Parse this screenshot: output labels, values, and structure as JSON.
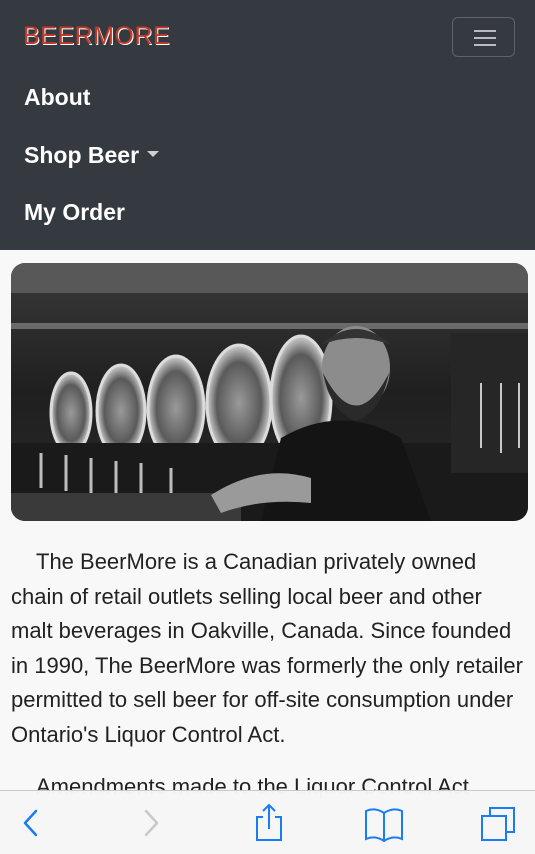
{
  "navbar": {
    "brand": "BEERMORE",
    "items": [
      {
        "label": "About"
      },
      {
        "label": "Shop Beer"
      },
      {
        "label": "My Order"
      }
    ]
  },
  "hero": {
    "image": "bartender-with-beer-taps-photo"
  },
  "content": {
    "paragraph1": "The BeerMore is a Canadian privately owned chain of retail outlets selling local beer and other malt beverages in Oakville, Canada. Since founded in 1990, The BeerMore was formerly the only retailer permitted to sell beer for off-site consumption under Ontario's Liquor Control Act.",
    "paragraph2": "Amendments made to the Liquor Control Act"
  },
  "toolbar": {
    "icons": [
      "back-icon",
      "forward-icon",
      "share-icon",
      "bookmarks-icon",
      "tabs-icon"
    ]
  },
  "colors": {
    "navbar": "#343a40",
    "brand": "#c0392b",
    "accent": "#1a7cf5"
  }
}
